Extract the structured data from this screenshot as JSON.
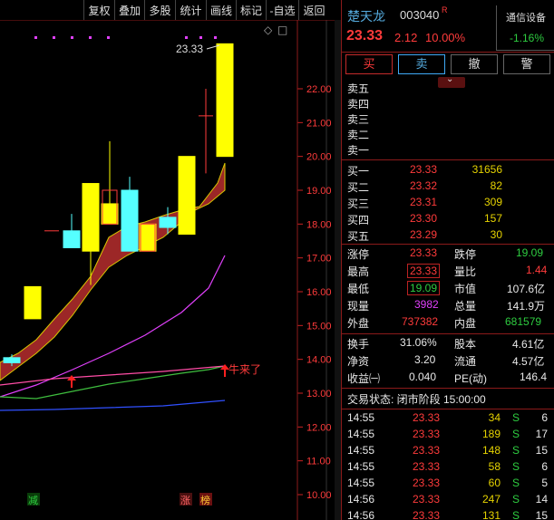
{
  "toolbar": [
    "复权",
    "叠加",
    "多股",
    "统计",
    "画线",
    "标记",
    "-自选",
    "返回"
  ],
  "chart": {
    "y_ticks": [
      "22.00",
      "21.00",
      "20.00",
      "19.00",
      "18.00",
      "17.00",
      "16.00",
      "15.00",
      "14.00",
      "13.00",
      "12.00",
      "11.00",
      "10.00"
    ],
    "max_price_label": "23.33",
    "annotation": "牛来了",
    "bottom_marks": {
      "left": "减",
      "zhang": "涨",
      "bang": "榜"
    },
    "diamond": "◇",
    "colors": {
      "up": "#ffff00",
      "down": "#5ff",
      "band": "#a52a2a",
      "ma_magenta": "#e040fb",
      "ma_green": "#3fbf3f",
      "ma_blue": "#3050ff",
      "ma_pink": "#ff4da6"
    }
  },
  "header": {
    "name": "楚天龙",
    "code": "003040",
    "tag": "R",
    "sector": "通信设备",
    "sector_change": "-1.16%",
    "price": "23.33",
    "change": "2.12",
    "change_pct": "10.00%"
  },
  "buttons": {
    "buy": "买",
    "sell": "卖",
    "cancel": "撤",
    "alert": "警"
  },
  "asks": [
    {
      "label": "卖五"
    },
    {
      "label": "卖四"
    },
    {
      "label": "卖三"
    },
    {
      "label": "卖二"
    },
    {
      "label": "卖一"
    }
  ],
  "bids": [
    {
      "label": "买一",
      "price": "23.33",
      "volume": "31656"
    },
    {
      "label": "买二",
      "price": "23.32",
      "volume": "82"
    },
    {
      "label": "买三",
      "price": "23.31",
      "volume": "309"
    },
    {
      "label": "买四",
      "price": "23.30",
      "volume": "157"
    },
    {
      "label": "买五",
      "price": "23.29",
      "volume": "30"
    }
  ],
  "stats": {
    "zhangting_label": "涨停",
    "zhangting": "23.33",
    "dieting_label": "跌停",
    "dieting": "19.09",
    "high_label": "最高",
    "high": "23.33",
    "liangbi_label": "量比",
    "liangbi": "1.44",
    "low_label": "最低",
    "low": "19.09",
    "shizhi_label": "市值",
    "shizhi": "107.6亿",
    "xianliang_label": "现量",
    "xianliang": "3982",
    "zongliang_label": "总量",
    "zongliang": "141.9万",
    "waipan_label": "外盘",
    "waipan": "737382",
    "neipan_label": "内盘",
    "neipan": "681579",
    "huanshou_label": "换手",
    "huanshou": "31.06%",
    "guben_label": "股本",
    "guben": "4.61亿",
    "jingzi_label": "净资",
    "jingzi": "3.20",
    "liutong_label": "流通",
    "liutong": "4.57亿",
    "shouyi_label": "收益㈠",
    "shouyi": "0.040",
    "pe_label": "PE(动)",
    "pe": "146.4"
  },
  "trade_status": "交易状态: 闭市阶段 15:00:00",
  "ticks": [
    {
      "time": "14:55",
      "price": "23.33",
      "vol": "34",
      "side": "S",
      "n": "6"
    },
    {
      "time": "14:55",
      "price": "23.33",
      "vol": "189",
      "side": "S",
      "n": "17"
    },
    {
      "time": "14:55",
      "price": "23.33",
      "vol": "148",
      "side": "S",
      "n": "15"
    },
    {
      "time": "14:55",
      "price": "23.33",
      "vol": "58",
      "side": "S",
      "n": "6"
    },
    {
      "time": "14:55",
      "price": "23.33",
      "vol": "60",
      "side": "S",
      "n": "5"
    },
    {
      "time": "14:56",
      "price": "23.33",
      "vol": "247",
      "side": "S",
      "n": "14"
    },
    {
      "time": "14:56",
      "price": "23.33",
      "vol": "131",
      "side": "S",
      "n": "15"
    }
  ]
}
